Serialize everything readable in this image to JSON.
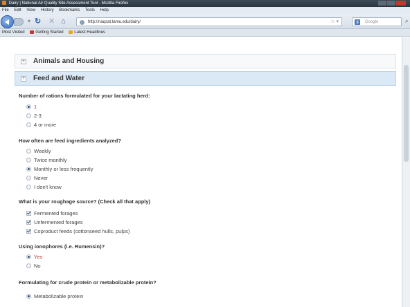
{
  "window": {
    "title": "Dairy | National Air Quality Site Assessment Tool - Mozilla Firefox"
  },
  "menu": [
    "File",
    "Edit",
    "View",
    "History",
    "Bookmarks",
    "Tools",
    "Help"
  ],
  "nav": {
    "url": "http://naqsat.tamu.edu/dairy/",
    "search_placeholder": "Google"
  },
  "bookmarks": [
    "Most Visited",
    "Getting Started",
    "Latest Headlines"
  ],
  "sections": {
    "animals": "Animals and Housing",
    "feed": "Feed and Water"
  },
  "questions": [
    {
      "text": "Number of rations formulated for your lactating herd:",
      "type": "radio",
      "options": [
        {
          "label": "1",
          "selected": true
        },
        {
          "label": "2-3",
          "selected": false
        },
        {
          "label": "4 or more",
          "selected": false
        }
      ]
    },
    {
      "text": "How often are feed ingredients analyzed?",
      "type": "radio",
      "options": [
        {
          "label": "Weekly",
          "selected": false
        },
        {
          "label": "Twice monthly",
          "selected": false
        },
        {
          "label": "Monthly or less frequently",
          "selected": true
        },
        {
          "label": "Never",
          "selected": false
        },
        {
          "label": "I don't know",
          "selected": false
        }
      ]
    },
    {
      "text": "What is your roughage source? (Check all that apply)",
      "type": "checkbox",
      "options": [
        {
          "label": "Fermented forages",
          "selected": true
        },
        {
          "label": "Unfermented forages",
          "selected": true
        },
        {
          "label": "Coproduct feeds (cottonseed hulls, pulps)",
          "selected": true
        }
      ]
    },
    {
      "text": "Using ionophores (i.e. Rumensin)?",
      "type": "radio",
      "options": [
        {
          "label": "Yes",
          "selected": true
        },
        {
          "label": "No",
          "selected": false
        }
      ]
    },
    {
      "text": "Formulating for crude protein or metabolizable protein?",
      "type": "radio",
      "options": [
        {
          "label": "Metabolizable protein",
          "selected": true
        }
      ]
    }
  ],
  "colors": {
    "active_section_bg": "#dbe8f6",
    "selected_option_text": "#c0392b",
    "accent": "#2f4f7a"
  }
}
